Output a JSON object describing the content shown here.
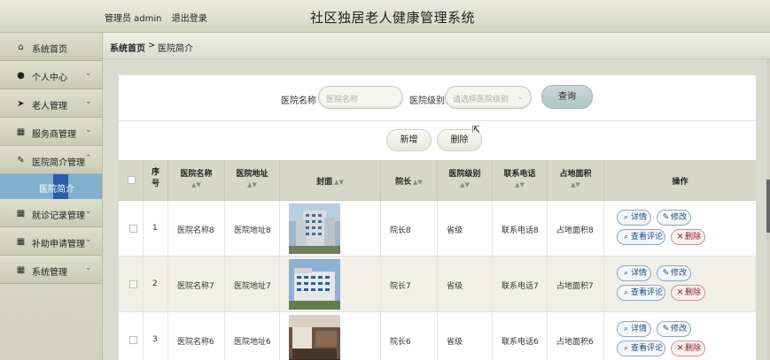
{
  "header": {
    "role_label": "管理员 admin",
    "logout_label": "退出登录",
    "system_title": "社区独居老人健康管理系统"
  },
  "sidebar": {
    "items": [
      {
        "label": "系统首页",
        "icon": "home-icon",
        "glyph": "⌂",
        "has_chevron": false
      },
      {
        "label": "个人中心",
        "icon": "user-icon",
        "glyph": "●",
        "has_chevron": true
      },
      {
        "label": "老人管理",
        "icon": "send-icon",
        "glyph": "➤",
        "has_chevron": true
      },
      {
        "label": "服务商管理",
        "icon": "grid-icon",
        "glyph": "▦",
        "has_chevron": true
      },
      {
        "label": "医院简介管理",
        "icon": "edit-icon",
        "glyph": "✎",
        "has_chevron": true
      },
      {
        "label": "就诊记录管理",
        "icon": "grid-icon",
        "glyph": "▦",
        "has_chevron": true
      },
      {
        "label": "补助申请管理",
        "icon": "grid-icon",
        "glyph": "▦",
        "has_chevron": true
      },
      {
        "label": "系统管理",
        "icon": "grid-icon",
        "glyph": "▦",
        "has_chevron": true
      }
    ],
    "active_sub_item": "医院简介"
  },
  "breadcrumb": {
    "home": "系统首页",
    "separator": ">",
    "current": "医院简介"
  },
  "search": {
    "name_label": "医院名称",
    "name_placeholder": "医院名称",
    "level_label": "医院级别",
    "level_placeholder": "请选择医院级别",
    "query_button": "查询"
  },
  "actions": {
    "add_button": "新增",
    "delete_button": "删除"
  },
  "table": {
    "headers": {
      "index": "序号",
      "name": "医院名称",
      "address": "医院地址",
      "cover": "封面",
      "dean": "院长",
      "level": "医院级别",
      "phone": "联系电话",
      "area": "占地面积",
      "ops": "操作"
    },
    "rows": [
      {
        "index": "1",
        "name": "医院名称8",
        "address": "医院地址8",
        "dean": "院长8",
        "level": "省级",
        "phone": "联系电话8",
        "area": "占地面积8"
      },
      {
        "index": "2",
        "name": "医院名称7",
        "address": "医院地址7",
        "dean": "院长7",
        "level": "省级",
        "phone": "联系电话7",
        "area": "占地面积7"
      },
      {
        "index": "3",
        "name": "医院名称6",
        "address": "医院地址6",
        "dean": "院长6",
        "level": "省级",
        "phone": "联系电话6",
        "area": "占地面积6"
      }
    ],
    "row_ops": {
      "detail": "详情",
      "edit": "修改",
      "view_comments": "查看评论",
      "delete": "删除"
    }
  },
  "colors": {
    "sidebar_active": "#7fb1cf",
    "query_button": "#b9cccd",
    "delete_red": "#cc0000"
  }
}
